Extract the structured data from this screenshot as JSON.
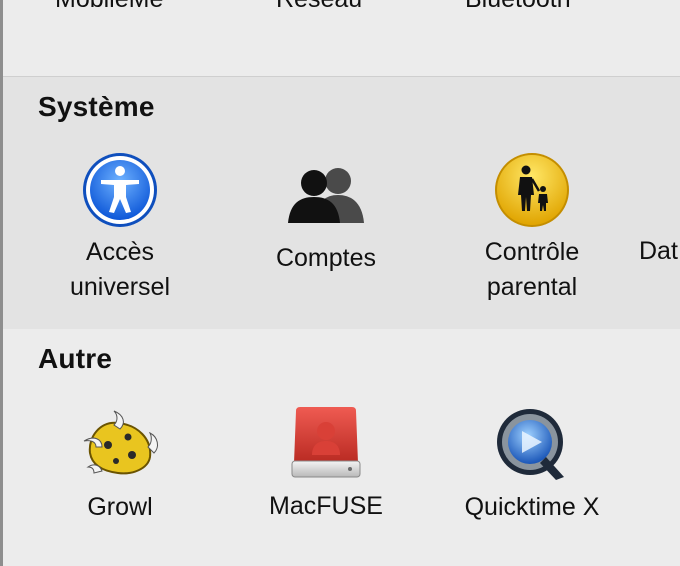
{
  "top_row": {
    "items": [
      {
        "label": "MobileMe"
      },
      {
        "label": "Réseau"
      },
      {
        "label": "Bluetooth"
      }
    ]
  },
  "system": {
    "title": "Système",
    "items": [
      {
        "label_line1": "Accès",
        "label_line2": "universel",
        "icon": "accessibility-icon"
      },
      {
        "label_line1": "Comptes",
        "icon": "accounts-icon"
      },
      {
        "label_line1": "Contrôle",
        "label_line2": "parental",
        "icon": "parental-controls-icon"
      },
      {
        "label_line1": "Dat"
      }
    ]
  },
  "other": {
    "title": "Autre",
    "items": [
      {
        "label": "Growl",
        "icon": "growl-icon"
      },
      {
        "label": "MacFUSE",
        "icon": "macfuse-icon"
      },
      {
        "label": "Quicktime X",
        "icon": "quicktime-icon"
      }
    ]
  },
  "colors": {
    "accessibility_blue": "#1d6ff2",
    "parental_yellow": "#f3c200",
    "macfuse_red": "#d93a32",
    "quicktime_blue": "#2a6fd6"
  }
}
